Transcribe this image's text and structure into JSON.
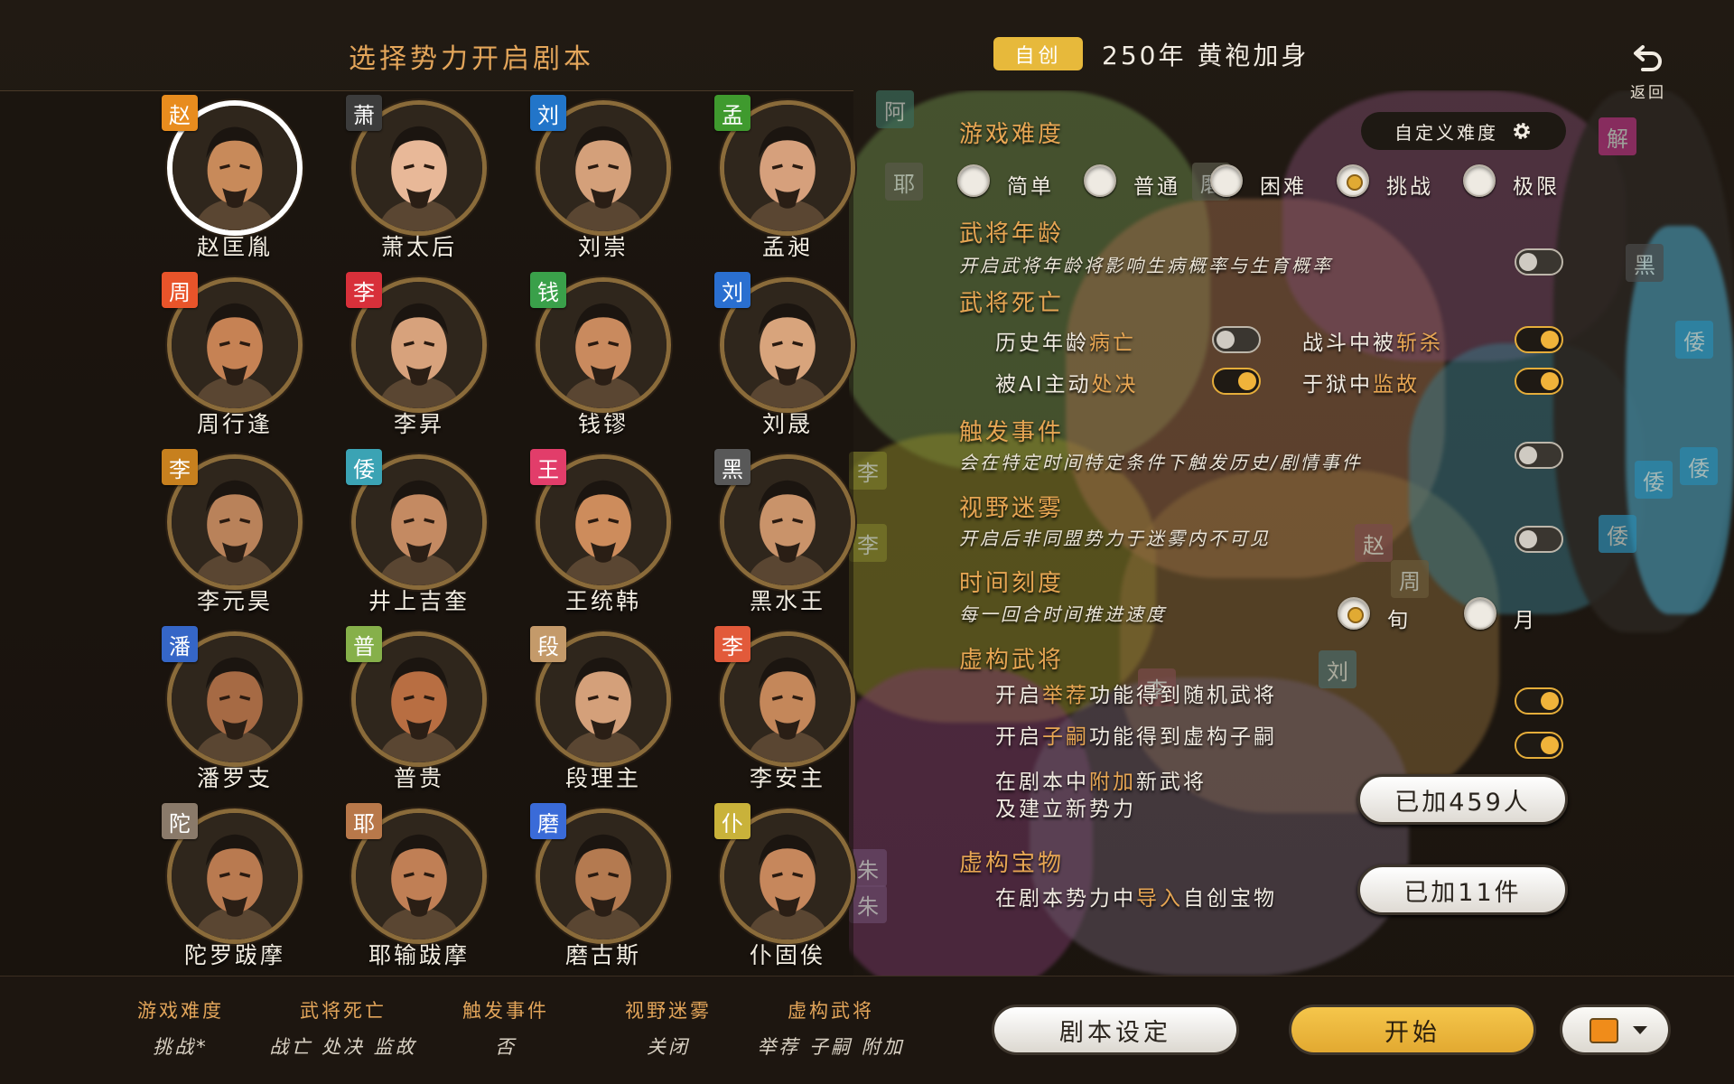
{
  "header": {
    "title": "选择势力开启剧本",
    "tag": "自创",
    "scenario": "250年  黄袍加身",
    "back_label": "返回"
  },
  "characters": [
    {
      "name": "赵匡胤",
      "faction": "赵",
      "color": "#e88c1e",
      "skin": "#c88a5a",
      "selected": true
    },
    {
      "name": "萧太后",
      "faction": "萧",
      "color": "#3c3c3c",
      "skin": "#e8b898",
      "selected": false
    },
    {
      "name": "刘崇",
      "faction": "刘",
      "color": "#2275c9",
      "skin": "#d4a07a",
      "selected": false
    },
    {
      "name": "孟昶",
      "faction": "孟",
      "color": "#3f9a2e",
      "skin": "#d6a07c",
      "selected": false
    },
    {
      "name": "周行逢",
      "faction": "周",
      "color": "#e8542a",
      "skin": "#c68254",
      "selected": false
    },
    {
      "name": "李昇",
      "faction": "李",
      "color": "#d8303a",
      "skin": "#d7a27c",
      "selected": false
    },
    {
      "name": "钱镠",
      "faction": "钱",
      "color": "#3aa04a",
      "skin": "#c98a5e",
      "selected": false
    },
    {
      "name": "刘晟",
      "faction": "刘",
      "color": "#2a6fd0",
      "skin": "#d8a47c",
      "selected": false
    },
    {
      "name": "李元昊",
      "faction": "李",
      "color": "#c7801e",
      "skin": "#b9825a",
      "selected": false
    },
    {
      "name": "井上吉奎",
      "faction": "倭",
      "color": "#3ba3b4",
      "skin": "#c48a62",
      "selected": false
    },
    {
      "name": "王统韩",
      "faction": "王",
      "color": "#e23d6a",
      "skin": "#cd8c5c",
      "selected": false
    },
    {
      "name": "黑水王",
      "faction": "黑",
      "color": "#585858",
      "skin": "#c9936a",
      "selected": false
    },
    {
      "name": "潘罗支",
      "faction": "潘",
      "color": "#3566c7",
      "skin": "#a66a44",
      "selected": false
    },
    {
      "name": "普贵",
      "faction": "普",
      "color": "#86b04a",
      "skin": "#b86e42",
      "selected": false
    },
    {
      "name": "段理主",
      "faction": "段",
      "color": "#c49a6a",
      "skin": "#d4a07a",
      "selected": false
    },
    {
      "name": "李安主",
      "faction": "李",
      "color": "#e25a3a",
      "skin": "#c4875a",
      "selected": false
    },
    {
      "name": "陀罗跋摩",
      "faction": "陀",
      "color": "#8a7a6a",
      "skin": "#b97a50",
      "selected": false
    },
    {
      "name": "耶输跋摩",
      "faction": "耶",
      "color": "#b8784a",
      "skin": "#c07f55",
      "selected": false
    },
    {
      "name": "磨古斯",
      "faction": "磨",
      "color": "#3a6bd8",
      "skin": "#b47a50",
      "selected": false
    },
    {
      "name": "仆固俟",
      "faction": "仆",
      "color": "#c9b23a",
      "skin": "#c6875c",
      "selected": false
    }
  ],
  "settings": {
    "difficulty": {
      "title": "游戏难度",
      "custom_label": "自定义难度",
      "options": [
        "简单",
        "普通",
        "困难",
        "挑战",
        "极限"
      ],
      "selected": "挑战"
    },
    "age": {
      "title": "武将年龄",
      "desc": "开启武将年龄将影响生病概率与生育概率",
      "on": false
    },
    "death": {
      "title": "武将死亡",
      "items": [
        {
          "pre": "历史年龄",
          "hl": "病亡",
          "post": "",
          "on": false
        },
        {
          "pre": "战斗中被",
          "hl": "斩杀",
          "post": "",
          "on": true
        },
        {
          "pre": "被AI主动",
          "hl": "处决",
          "post": "",
          "on": true
        },
        {
          "pre": "于狱中",
          "hl": "监故",
          "post": "",
          "on": true
        }
      ]
    },
    "events": {
      "title": "触发事件",
      "desc": "会在特定时间特定条件下触发历史/剧情事件",
      "on": false
    },
    "fog": {
      "title": "视野迷雾",
      "desc": "开启后非同盟势力于迷雾内不可见",
      "on": false
    },
    "time": {
      "title": "时间刻度",
      "desc": "每一回合时间推进速度",
      "options": [
        "旬",
        "月"
      ],
      "selected": "旬"
    },
    "fictional_generals": {
      "title": "虚构武将",
      "recommend": {
        "pre": "开启",
        "hl": "举荐",
        "post": "功能得到随机武将",
        "on": true
      },
      "heir": {
        "pre": "开启",
        "hl": "子嗣",
        "post": "功能得到虚构子嗣",
        "on": true
      },
      "add_line1_pre": "在剧本中",
      "add_line1_hl": "附加",
      "add_line1_post": "新武将",
      "add_line2": "及建立新势力",
      "add_button": "已加459人"
    },
    "fictional_treasures": {
      "title": "虚构宝物",
      "pre": "在剧本势力中",
      "hl": "导入",
      "post": "自创宝物",
      "button": "已加11件"
    }
  },
  "map_labels": [
    "阿",
    "解",
    "黑",
    "倭",
    "倭",
    "倭",
    "倭",
    "李",
    "李",
    "朱",
    "朱",
    "耶",
    "磨",
    "赵",
    "周",
    "刘",
    "李"
  ],
  "summary": [
    {
      "h": "游戏难度",
      "v": "挑战*"
    },
    {
      "h": "武将死亡",
      "v": "战亡 处决 监故"
    },
    {
      "h": "触发事件",
      "v": "否"
    },
    {
      "h": "视野迷雾",
      "v": "关闭"
    },
    {
      "h": "虚构武将",
      "v": "举荐 子嗣 附加"
    }
  ],
  "footer": {
    "settings_button": "剧本设定",
    "start_button": "开始",
    "player_color": "#f08c1a"
  }
}
